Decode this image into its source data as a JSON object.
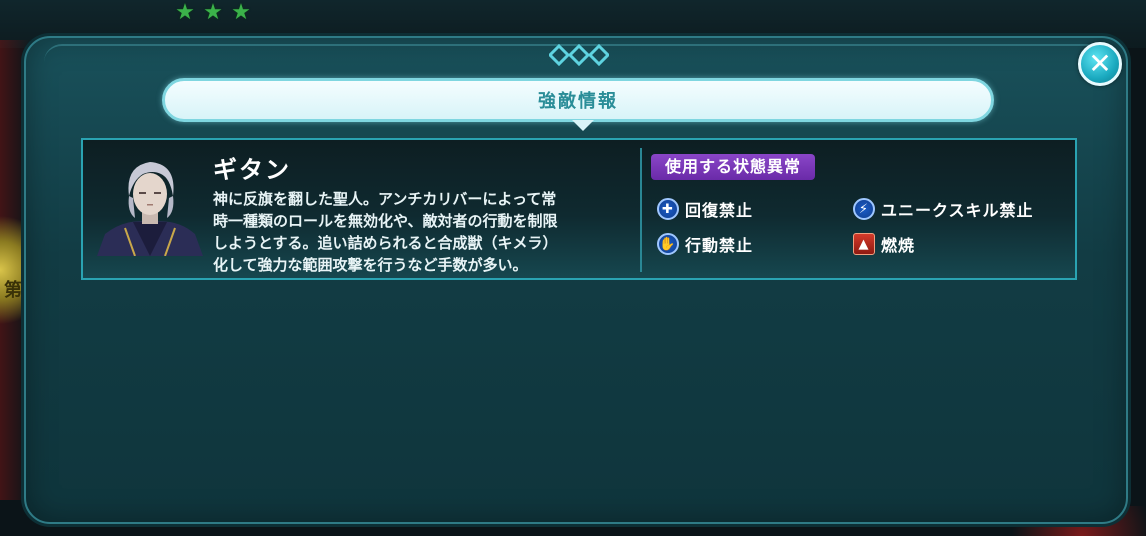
{
  "background": {
    "stars": [
      "★",
      "★",
      "★"
    ],
    "side_glyph": "第"
  },
  "dialog": {
    "title": "強敵情報",
    "close_label": "✕"
  },
  "enemy": {
    "name": "ギタン",
    "description_lines": [
      "神に反旗を翻した聖人。アンチカリバーによって常",
      "時一種類のロールを無効化や、敵対者の行動を制限",
      "しようとする。追い詰められると合成獣（キメラ）",
      "化して強力な範囲攻撃を行うなど手数が多い。"
    ]
  },
  "status_effects": {
    "header": "使用する状態異常",
    "items": [
      {
        "label": "回復禁止",
        "icon": "heal-ban-icon"
      },
      {
        "label": "ユニークスキル禁止",
        "icon": "unique-skill-ban-icon"
      },
      {
        "label": "行動禁止",
        "icon": "action-ban-icon"
      },
      {
        "label": "燃焼",
        "icon": "burn-icon"
      }
    ]
  },
  "colors": {
    "dialog_bg": "#123c44",
    "title_text": "#2a8d98",
    "status_header_bg": "#7a36b8",
    "close_button": "#1aa9bf"
  }
}
